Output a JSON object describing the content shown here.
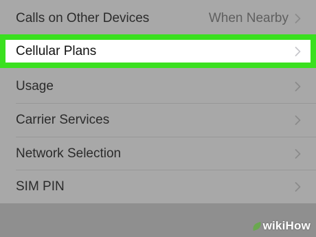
{
  "settings_list": {
    "rows": [
      {
        "label": "Calls on Other Devices",
        "value": "When Nearby"
      },
      {
        "label": "Cellular Plans",
        "value": ""
      },
      {
        "label": "Usage",
        "value": ""
      },
      {
        "label": "Carrier Services",
        "value": ""
      },
      {
        "label": "Network Selection",
        "value": ""
      },
      {
        "label": "SIM PIN",
        "value": ""
      }
    ]
  },
  "highlight_color": "#3ae01f",
  "watermark": {
    "wiki": "wiki",
    "how": "How"
  }
}
